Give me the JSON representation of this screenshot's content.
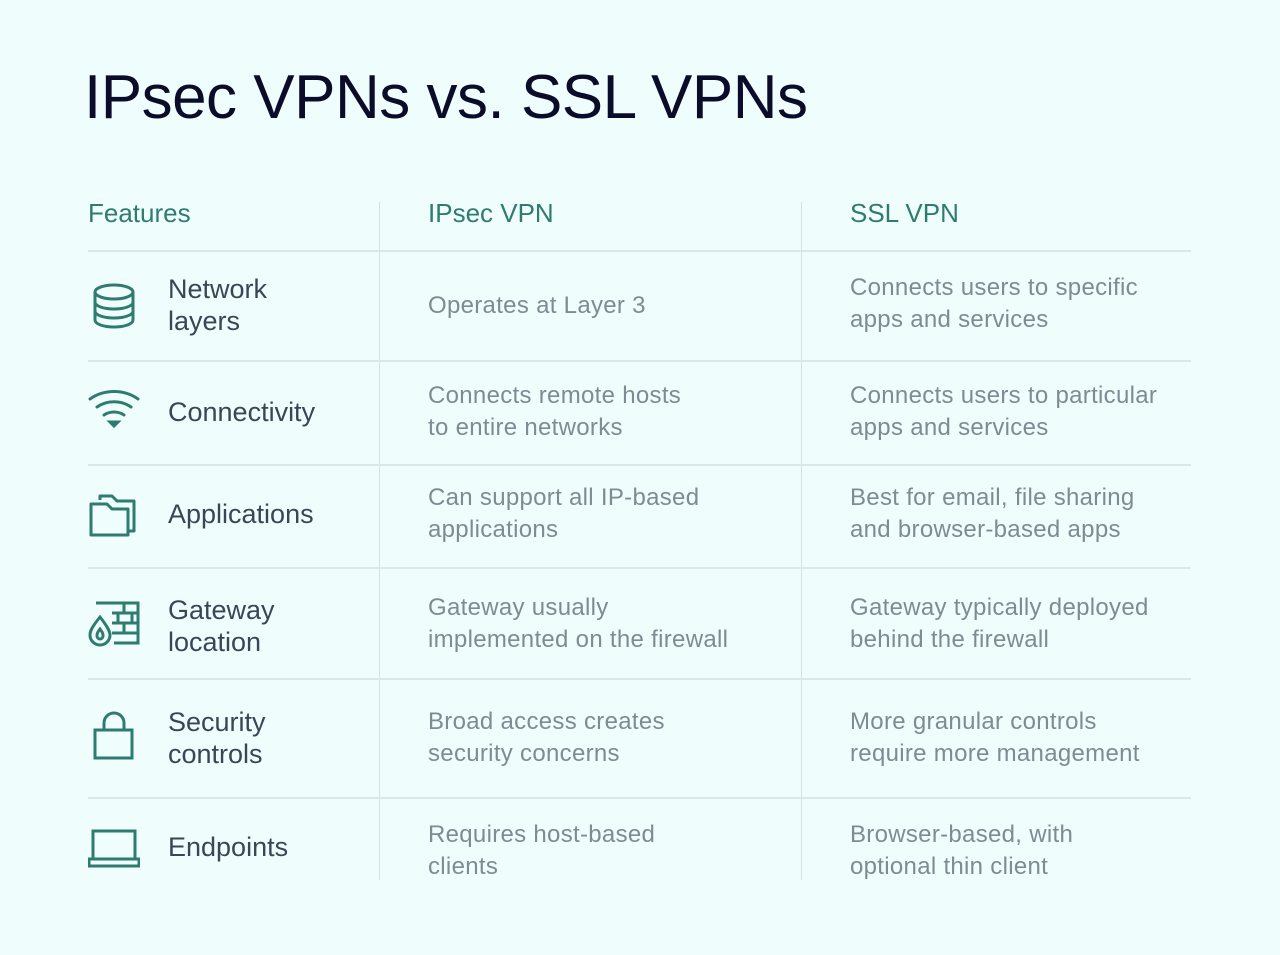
{
  "title": "IPsec VPNs vs. SSL VPNs",
  "colors": {
    "accent": "#2e7c70",
    "title": "#0b0c2a",
    "feature_text": "#3a4556",
    "cell_text": "#7f8b92",
    "background": "#f0fdfd"
  },
  "table": {
    "headers": [
      "Features",
      "IPsec VPN",
      "SSL VPN"
    ],
    "rows": [
      {
        "icon": "database-icon",
        "feature": [
          "Network",
          "layers"
        ],
        "ipsec": [
          "Operates at Layer 3"
        ],
        "ssl": [
          "Connects users to specific",
          "apps and services"
        ]
      },
      {
        "icon": "wifi-icon",
        "feature": [
          "Connectivity"
        ],
        "ipsec": [
          "Connects remote hosts",
          "to entire networks"
        ],
        "ssl": [
          "Connects users to particular",
          "apps and services"
        ]
      },
      {
        "icon": "folders-icon",
        "feature": [
          "Applications"
        ],
        "ipsec": [
          "Can support all IP-based",
          "applications"
        ],
        "ssl": [
          "Best for email, file sharing",
          "and browser-based apps"
        ]
      },
      {
        "icon": "firewall-icon",
        "feature": [
          "Gateway",
          "location"
        ],
        "ipsec": [
          "Gateway usually",
          "implemented on the firewall"
        ],
        "ssl": [
          "Gateway typically deployed",
          "behind the firewall"
        ]
      },
      {
        "icon": "lock-icon",
        "feature": [
          "Security",
          "controls"
        ],
        "ipsec": [
          "Broad access creates",
          "security concerns"
        ],
        "ssl": [
          "More granular controls",
          "require more management"
        ]
      },
      {
        "icon": "laptop-icon",
        "feature": [
          "Endpoints"
        ],
        "ipsec": [
          "Requires host-based",
          "clients"
        ],
        "ssl": [
          "Browser-based, with",
          "optional thin client"
        ]
      }
    ]
  }
}
